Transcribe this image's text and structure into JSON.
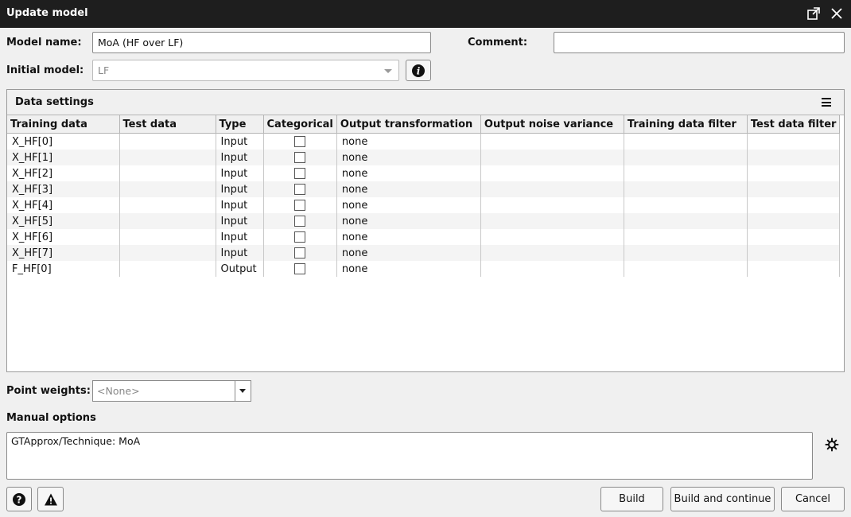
{
  "window": {
    "title": "Update model"
  },
  "form": {
    "model_name_label": "Model name:",
    "model_name_value": "MoA (HF over LF)",
    "comment_label": "Comment:",
    "comment_value": "",
    "initial_model_label": "Initial model:",
    "initial_model_value": "LF"
  },
  "data_settings": {
    "title": "Data settings",
    "columns": [
      "Training data",
      "Test data",
      "Type",
      "Categorical",
      "Output transformation",
      "Output noise variance",
      "Training data filter",
      "Test data filter"
    ],
    "rows": [
      {
        "training": "X_HF[0]",
        "test": "",
        "type": "Input",
        "categorical": false,
        "transform": "none",
        "noise": "",
        "train_filter": "",
        "test_filter": ""
      },
      {
        "training": "X_HF[1]",
        "test": "",
        "type": "Input",
        "categorical": false,
        "transform": "none",
        "noise": "",
        "train_filter": "",
        "test_filter": ""
      },
      {
        "training": "X_HF[2]",
        "test": "",
        "type": "Input",
        "categorical": false,
        "transform": "none",
        "noise": "",
        "train_filter": "",
        "test_filter": ""
      },
      {
        "training": "X_HF[3]",
        "test": "",
        "type": "Input",
        "categorical": false,
        "transform": "none",
        "noise": "",
        "train_filter": "",
        "test_filter": ""
      },
      {
        "training": "X_HF[4]",
        "test": "",
        "type": "Input",
        "categorical": false,
        "transform": "none",
        "noise": "",
        "train_filter": "",
        "test_filter": ""
      },
      {
        "training": "X_HF[5]",
        "test": "",
        "type": "Input",
        "categorical": false,
        "transform": "none",
        "noise": "",
        "train_filter": "",
        "test_filter": ""
      },
      {
        "training": "X_HF[6]",
        "test": "",
        "type": "Input",
        "categorical": false,
        "transform": "none",
        "noise": "",
        "train_filter": "",
        "test_filter": ""
      },
      {
        "training": "X_HF[7]",
        "test": "",
        "type": "Input",
        "categorical": false,
        "transform": "none",
        "noise": "",
        "train_filter": "",
        "test_filter": ""
      },
      {
        "training": "F_HF[0]",
        "test": "",
        "type": "Output",
        "categorical": false,
        "transform": "none",
        "noise": "",
        "train_filter": "",
        "test_filter": ""
      }
    ]
  },
  "point_weights": {
    "label": "Point weights:",
    "value": "<None>"
  },
  "manual_options": {
    "label": "Manual options",
    "text": "GTApprox/Technique: MoA"
  },
  "buttons": {
    "build": "Build",
    "build_continue": "Build and continue",
    "cancel": "Cancel"
  }
}
